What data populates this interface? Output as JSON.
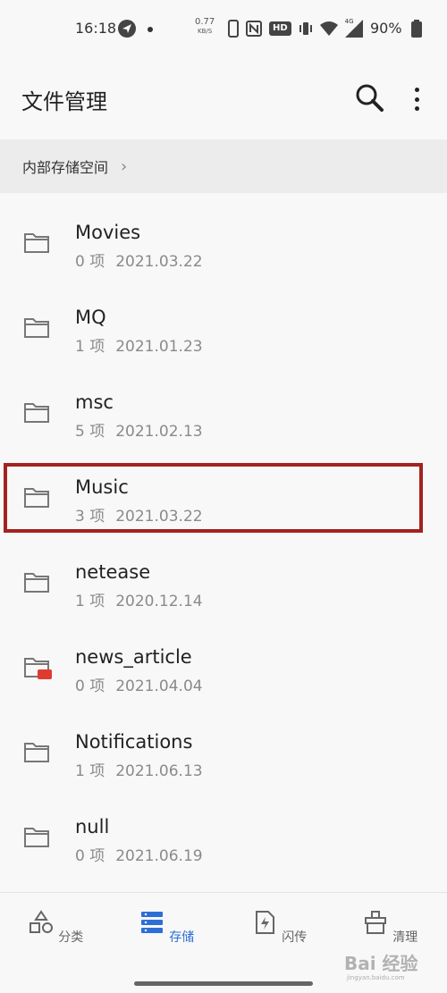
{
  "status_bar": {
    "time": "16:18",
    "net_speed_value": "0.77",
    "net_speed_unit": "KB/S",
    "hd_label": "HD",
    "network_label": "4G",
    "battery_percent": "90%"
  },
  "app_bar": {
    "title": "文件管理"
  },
  "breadcrumb": {
    "path": "内部存储空间",
    "chevron": "›"
  },
  "files": [
    {
      "name": "Movies",
      "count": "0 项",
      "date": "2021.03.22",
      "icon": "folder-icon"
    },
    {
      "name": "MQ",
      "count": "1 项",
      "date": "2021.01.23",
      "icon": "folder-icon"
    },
    {
      "name": "msc",
      "count": "5 项",
      "date": "2021.02.13",
      "icon": "folder-icon"
    },
    {
      "name": "Music",
      "count": "3 项",
      "date": "2021.03.22",
      "icon": "folder-icon",
      "highlighted": true
    },
    {
      "name": "netease",
      "count": "1 项",
      "date": "2020.12.14",
      "icon": "folder-icon"
    },
    {
      "name": "news_article",
      "count": "0 项",
      "date": "2021.04.04",
      "icon": "folder-app-icon"
    },
    {
      "name": "Notifications",
      "count": "1 项",
      "date": "2021.06.13",
      "icon": "folder-icon"
    },
    {
      "name": "null",
      "count": "0 项",
      "date": "2021.06.19",
      "icon": "folder-icon"
    }
  ],
  "bottom_nav": [
    {
      "label": "分类",
      "icon": "category-icon",
      "active": false
    },
    {
      "label": "存储",
      "icon": "storage-icon",
      "active": true
    },
    {
      "label": "闪传",
      "icon": "flash-transfer-icon",
      "active": false
    },
    {
      "label": "清理",
      "icon": "cleanup-icon",
      "active": false
    }
  ],
  "colors": {
    "accent": "#2d6fd6",
    "highlight_border": "#a3221e",
    "text_secondary": "#8a8a8a"
  },
  "watermark": {
    "text": "Bai 经验",
    "sub": "jingyan.baidu.com"
  }
}
